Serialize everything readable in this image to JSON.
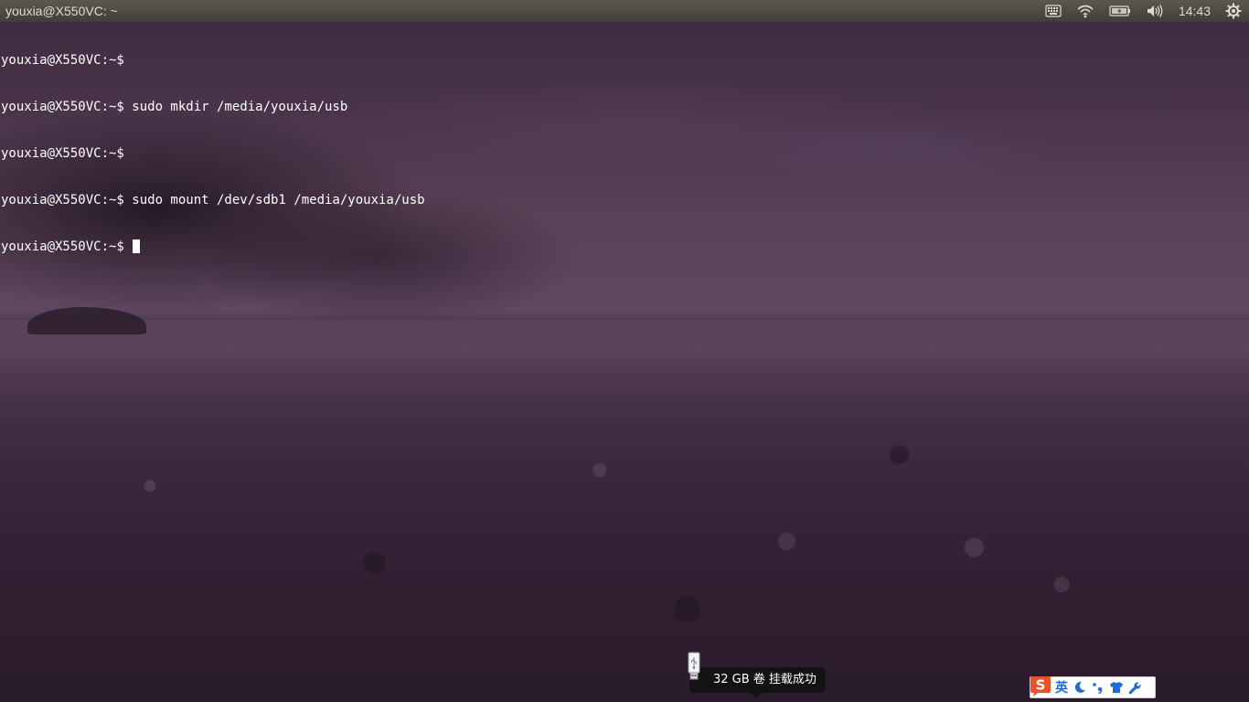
{
  "top_panel": {
    "window_title": "youxia@X550VC: ~",
    "indicators": [
      {
        "icon": "keyboard-icon"
      },
      {
        "icon": "wifi-icon"
      },
      {
        "icon": "battery-icon"
      },
      {
        "icon": "volume-icon"
      }
    ],
    "clock": "14:43",
    "session_icon": "gear-power-icon"
  },
  "terminal": {
    "lines": [
      "youxia@X550VC:~$ ",
      "youxia@X550VC:~$ sudo mkdir /media/youxia/usb",
      "youxia@X550VC:~$ ",
      "youxia@X550VC:~$ sudo mount /dev/sdb1 /media/youxia/usb",
      "youxia@X550VC:~$ "
    ]
  },
  "notification": {
    "icon": "usb-drive-icon",
    "text": "32 GB 卷 挂载成功"
  },
  "ime_toolbar": {
    "logo_letter": "S",
    "lang_label": "英",
    "items": [
      {
        "icon": "moon-icon"
      },
      {
        "icon": "punctuation-icon"
      },
      {
        "icon": "skin-shirt-icon"
      },
      {
        "icon": "wrench-icon"
      }
    ]
  },
  "colors": {
    "panel": "#4a4842",
    "terminal_text": "#ffffff",
    "wallpaper_tint": "#4a334a",
    "ime_blue": "#1e6ed1",
    "ime_logo": "#e8532a"
  }
}
